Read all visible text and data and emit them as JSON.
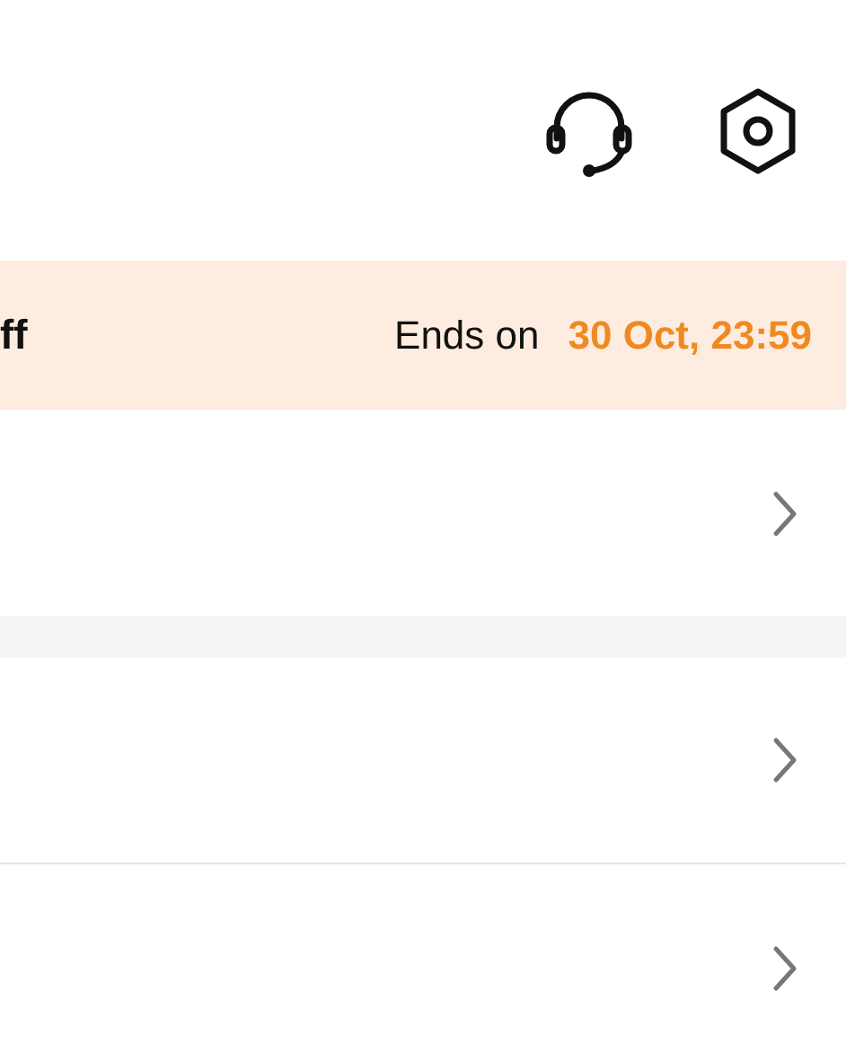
{
  "promo_banner": {
    "title": "ff",
    "ends_label": "Ends on",
    "end_time": "30 Oct, 23:59"
  }
}
